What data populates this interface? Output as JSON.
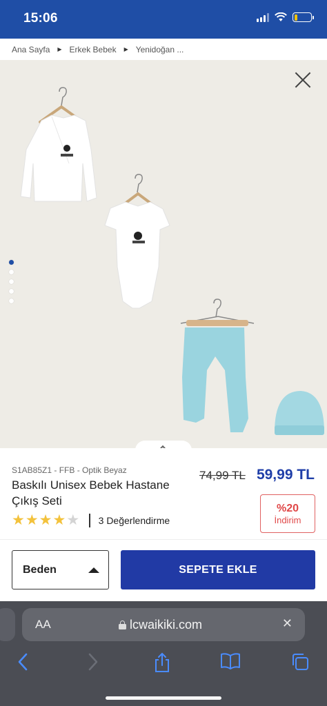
{
  "status_bar": {
    "time": "15:06",
    "battery_color": "#f2c200",
    "battery_level": 0.2
  },
  "breadcrumb": [
    "Ana Sayfa",
    "Erkek Bebek",
    "Yenidoğan ..."
  ],
  "gallery": {
    "image_count": 5,
    "active_index": 0
  },
  "product": {
    "sku_line": "S1AB85Z1 - FFB - Optik Beyaz",
    "title": "Baskılı Unisex Bebek Hastane Çıkış Seti",
    "old_price": "74,99 TL",
    "new_price": "59,99 TL",
    "discount_pct": "%20",
    "discount_label": "İndirim",
    "rating_stars": 4,
    "rating_max": 5,
    "reviews": "3 Değerlendirme"
  },
  "actions": {
    "size_label": "Beden",
    "add_to_cart_label": "SEPETE EKLE"
  },
  "browser": {
    "aa_label": "AA",
    "url": "lcwaikiki.com"
  },
  "colors": {
    "brand_blue": "#1f4ea6",
    "button_blue": "#213aa5",
    "discount_red": "#e04848",
    "star_yellow": "#f3c23c"
  }
}
